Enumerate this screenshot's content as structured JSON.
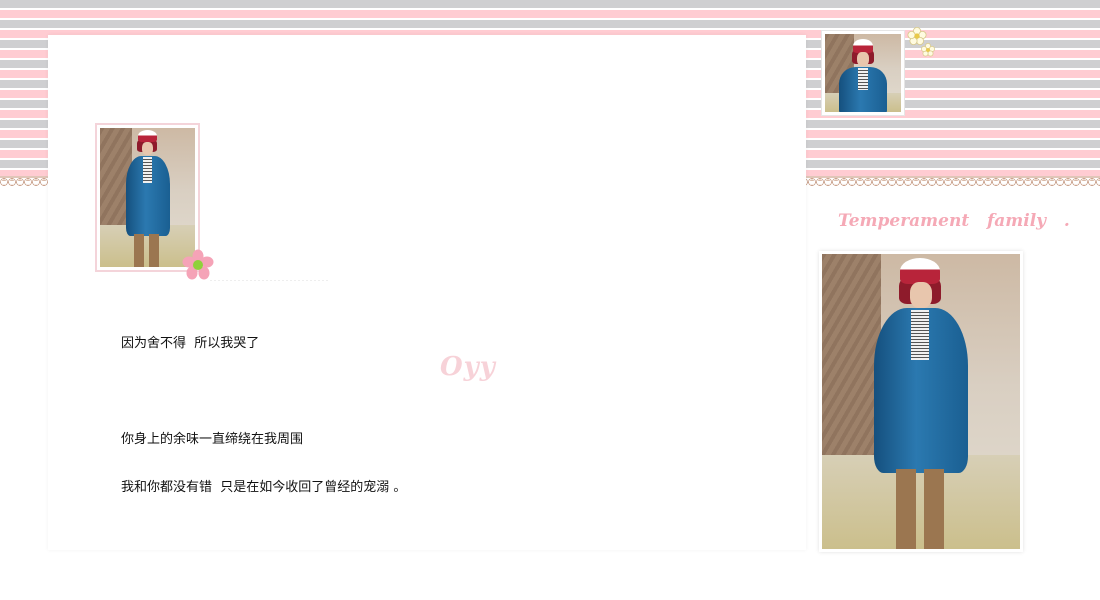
{
  "colors": {
    "stripe_gray": "#cfcfd1",
    "stripe_pink": "#ffccd2",
    "accent_pink": "#f5a9b6",
    "watermark_pink": "#f7d2d8",
    "text": "#111111"
  },
  "content": {
    "line1": "因为舍不得  所以我哭了",
    "line2": "你身上的余味一直缔绕在我周围",
    "line3": "我和你都没有错  只是在如今收回了曾经的宠溺 。"
  },
  "watermark": "Oyy",
  "sidebar": {
    "title": "Temperament   family   ."
  },
  "icons": {
    "flower_main": "pink-flower-icon",
    "flower_top": "small-daisy-icon"
  }
}
